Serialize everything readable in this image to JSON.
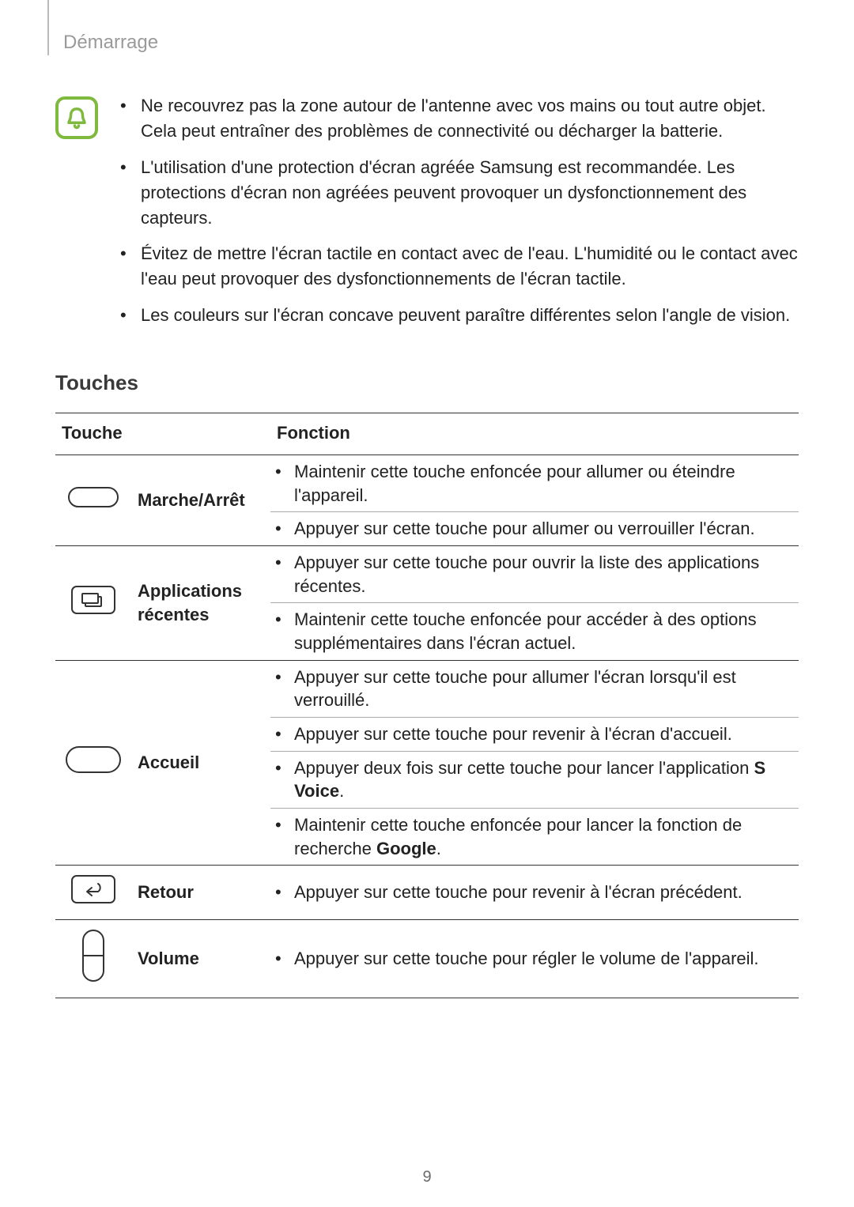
{
  "header": {
    "title": "Démarrage"
  },
  "notes": {
    "items": [
      "Ne recouvrez pas la zone autour de l'antenne avec vos mains ou tout autre objet. Cela peut entraîner des problèmes de connectivité ou décharger la batterie.",
      "L'utilisation d'une protection d'écran agréée Samsung est recommandée. Les protections d'écran non agréées peuvent provoquer un dysfonctionnement des capteurs.",
      "Évitez de mettre l'écran tactile en contact avec de l'eau. L'humidité ou le contact avec l'eau peut provoquer des dysfonctionnements de l'écran tactile.",
      "Les couleurs sur l'écran concave peuvent paraître différentes selon l'angle de vision."
    ]
  },
  "section": {
    "heading": "Touches"
  },
  "table": {
    "head": {
      "col1": "Touche",
      "col2": "Fonction"
    },
    "rows": {
      "power": {
        "label": "Marche/Arrêt",
        "f1": "Maintenir cette touche enfoncée pour allumer ou éteindre l'appareil.",
        "f2": "Appuyer sur cette touche pour allumer ou verrouiller l'écran."
      },
      "recent": {
        "label": "Applications récentes",
        "f1": "Appuyer sur cette touche pour ouvrir la liste des applications récentes.",
        "f2": "Maintenir cette touche enfoncée pour accéder à des options supplémentaires dans l'écran actuel."
      },
      "home": {
        "label": "Accueil",
        "f1": "Appuyer sur cette touche pour allumer l'écran lorsqu'il est verrouillé.",
        "f2": "Appuyer sur cette touche pour revenir à l'écran d'accueil.",
        "f3a": "Appuyer deux fois sur cette touche pour lancer l'application ",
        "f3b": "S Voice",
        "f3c": ".",
        "f4a": "Maintenir cette touche enfoncée pour lancer la fonction de recherche ",
        "f4b": "Google",
        "f4c": "."
      },
      "back": {
        "label": "Retour",
        "f1": "Appuyer sur cette touche pour revenir à l'écran précédent."
      },
      "volume": {
        "label": "Volume",
        "f1": "Appuyer sur cette touche pour régler le volume de l'appareil."
      }
    }
  },
  "page_number": "9"
}
